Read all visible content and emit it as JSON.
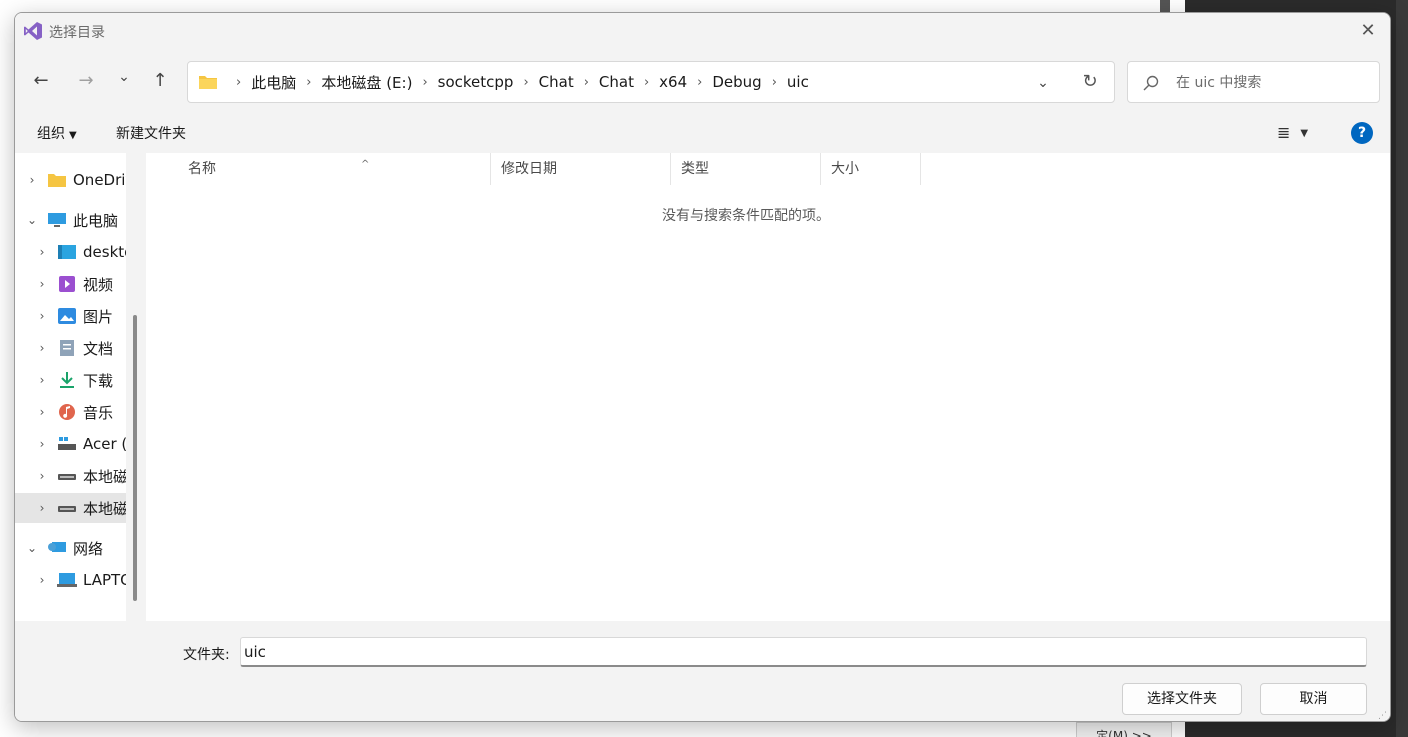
{
  "background": {
    "bottom_button_label": "定(M) >>"
  },
  "dialog": {
    "title": "选择目录",
    "close_label": "✕"
  },
  "nav": {
    "back_label": "←",
    "forward_label": "→",
    "recent_label": "⌄",
    "up_label": "↑",
    "breadcrumb": [
      "此电脑",
      "本地磁盘 (E:)",
      "socketcpp",
      "Chat",
      "Chat",
      "x64",
      "Debug",
      "uic"
    ],
    "breadcrumb_separator": "›",
    "dropdown_label": "⌄",
    "refresh_label": "↻",
    "search_placeholder": "在 uic 中搜索"
  },
  "toolbar": {
    "organize_label": "组织",
    "new_folder_label": "新建文件夹",
    "view_label": "≣",
    "help_label": "?"
  },
  "navpane": {
    "items": [
      {
        "label": "OneDrive",
        "chevron": "›",
        "icon": "folder-icon"
      },
      {
        "label": "此电脑",
        "chevron": "⌄",
        "icon": "computer-icon"
      },
      {
        "label": "desktop",
        "chevron": "›",
        "icon": "desktop-icon"
      },
      {
        "label": "视频",
        "chevron": "›",
        "icon": "video-icon"
      },
      {
        "label": "图片",
        "chevron": "›",
        "icon": "picture-icon"
      },
      {
        "label": "文档",
        "chevron": "›",
        "icon": "document-icon"
      },
      {
        "label": "下载",
        "chevron": "›",
        "icon": "download-icon"
      },
      {
        "label": "音乐",
        "chevron": "›",
        "icon": "music-icon"
      },
      {
        "label": "Acer (",
        "chevron": "›",
        "icon": "drive-icon"
      },
      {
        "label": "本地磁盘",
        "chevron": "›",
        "icon": "disk-icon"
      },
      {
        "label": "本地磁盘",
        "chevron": "›",
        "icon": "disk-icon"
      },
      {
        "label": "网络",
        "chevron": "⌄",
        "icon": "network-icon"
      },
      {
        "label": "LAPTOP",
        "chevron": "›",
        "icon": "laptop-icon"
      }
    ]
  },
  "filelist": {
    "columns": [
      "名称",
      "修改日期",
      "类型",
      "大小"
    ],
    "sort_indicator": "^",
    "empty_message": "没有与搜索条件匹配的项。"
  },
  "footer": {
    "folder_label": "文件夹:",
    "folder_value": "uic",
    "select_button": "选择文件夹",
    "cancel_button": "取消"
  },
  "colors": {
    "accent": "#0067c0",
    "chrome": "#f3f3f3",
    "selected_row": "#e5e5e5"
  }
}
